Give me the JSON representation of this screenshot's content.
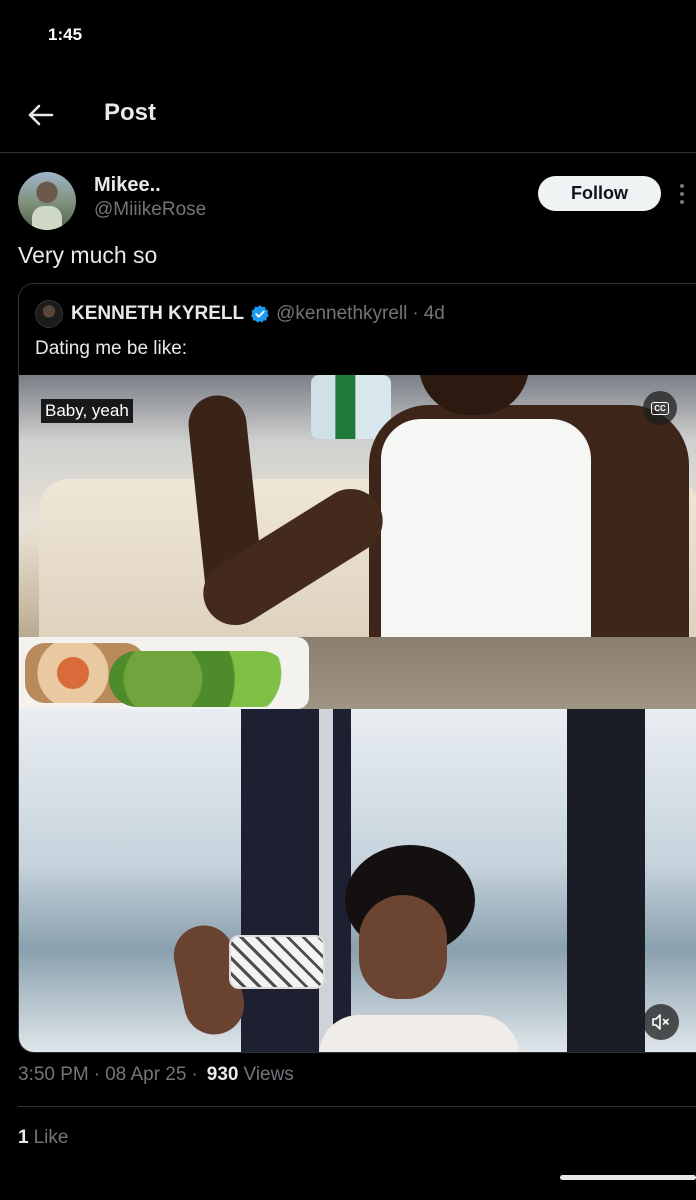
{
  "status_bar": {
    "time": "1:45"
  },
  "nav": {
    "title": "Post",
    "back_icon": "arrow-left-icon"
  },
  "post": {
    "author_name": "Mikee..",
    "author_handle": "@MiiikeRose",
    "follow_label": "Follow",
    "text": "Very much so",
    "timestamp": "3:50 PM",
    "date": "08 Apr 25",
    "views_count": "930",
    "views_label": "Views",
    "likes_count": "1",
    "likes_label": "Like"
  },
  "quote": {
    "name": "KENNETH KYRELL",
    "handle": "@kennethkyrell",
    "age": "4d",
    "text": "Dating me be like:",
    "verified_color": "#1d9bf0"
  },
  "video": {
    "caption": "Baby, yeah",
    "cc_label": "CC"
  }
}
